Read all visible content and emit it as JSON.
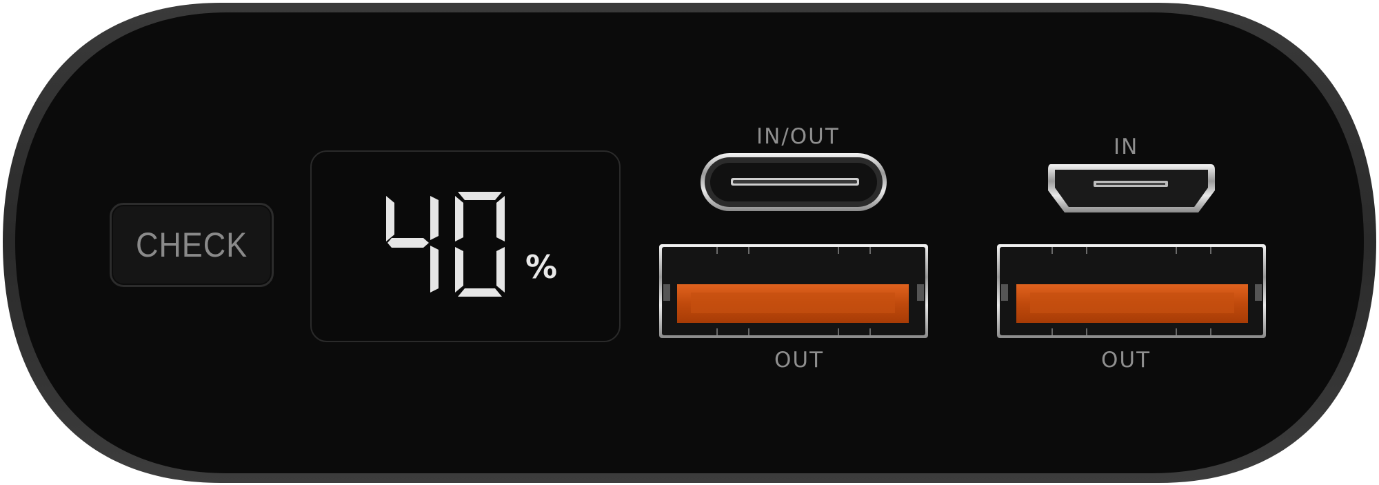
{
  "device": {
    "body_color": "#0a0a0a",
    "rim_color": "#3b3b3b",
    "check_button": {
      "label": "CHECK"
    },
    "display": {
      "battery_percent": 40,
      "digits": "40",
      "unit": "%",
      "segment_color": "#e6e6e6"
    },
    "ports": {
      "usb_c": {
        "label": "IN/OUT"
      },
      "micro_usb": {
        "label": "IN"
      },
      "usb_a_left": {
        "label": "OUT",
        "tongue_color": "#c84d10"
      },
      "usb_a_right": {
        "label": "OUT",
        "tongue_color": "#c84d10"
      }
    }
  }
}
